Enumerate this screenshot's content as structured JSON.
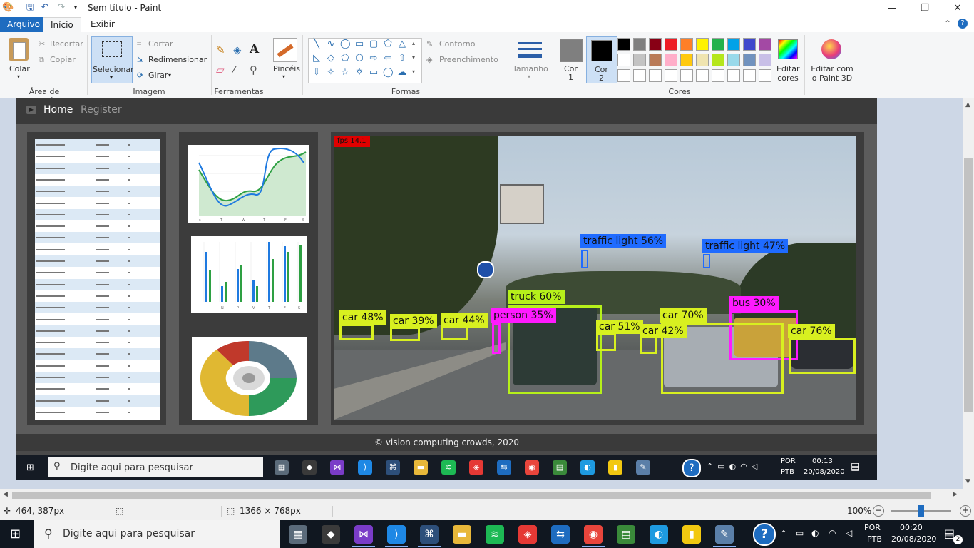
{
  "window": {
    "title": "Sem título - Paint",
    "controls": [
      "—",
      "❐",
      "✕"
    ]
  },
  "tabs": {
    "file": "Arquivo",
    "home": "Início",
    "view": "Exibir"
  },
  "ribbon": {
    "clipboard": {
      "paste": "Colar",
      "cut": "Recortar",
      "copy": "Copiar",
      "group": "Área de Transferência"
    },
    "image": {
      "select": "Selecionar",
      "crop": "Cortar",
      "resize": "Redimensionar",
      "rotate": "Girar",
      "group": "Imagem"
    },
    "tools": {
      "group": "Ferramentas"
    },
    "brushes": {
      "label": "Pincéis"
    },
    "shapes": {
      "outline": "Contorno",
      "fill": "Preenchimento",
      "group": "Formas"
    },
    "size": {
      "label": "Tamanho"
    },
    "colors": {
      "color1_label": "Cor",
      "color1_num": "1",
      "color2_label": "Cor",
      "color2_num": "2",
      "color1": "#7f7f7f",
      "color2": "#000000",
      "palette_row1": [
        "#000000",
        "#7f7f7f",
        "#880015",
        "#ed1c24",
        "#ff7f27",
        "#fff200",
        "#22b14c",
        "#00a2e8",
        "#3f48cc",
        "#a349a4"
      ],
      "palette_row2": [
        "#ffffff",
        "#c3c3c3",
        "#b97a57",
        "#ffaec9",
        "#ffc90e",
        "#efe4b0",
        "#b5e61d",
        "#99d9ea",
        "#7092be",
        "#c8bfe7"
      ],
      "edit_colors": "Editar cores",
      "group": "Cores"
    },
    "paint3d": "Editar com o Paint 3D"
  },
  "embedded": {
    "nav": {
      "home": "Home",
      "register": "Register"
    },
    "fps": "fps 14.1",
    "detections": [
      {
        "label": "traffic light 56%",
        "color": "#1f6bff"
      },
      {
        "label": "traffic light 47%",
        "color": "#1f6bff"
      },
      {
        "label": "truck 60%",
        "color": "#b6f01a"
      },
      {
        "label": "person 35%",
        "color": "#ff1aff"
      },
      {
        "label": "bus 30%",
        "color": "#ff1aff"
      },
      {
        "label": "car 48%",
        "color": "#d8f020"
      },
      {
        "label": "car 39%",
        "color": "#d8f020"
      },
      {
        "label": "car 44%",
        "color": "#d8f020"
      },
      {
        "label": "car 51%",
        "color": "#d8f020"
      },
      {
        "label": "car 70%",
        "color": "#d8f020"
      },
      {
        "label": "car 42%",
        "color": "#d8f020"
      },
      {
        "label": "car 76%",
        "color": "#d8f020"
      }
    ],
    "footer": "© vision computing   crowds, 2020",
    "inner_taskbar": {
      "search": "Digite aqui para pesquisar",
      "lang1": "POR",
      "lang2": "PTB",
      "time": "00:13",
      "date": "20/08/2020"
    }
  },
  "statusbar": {
    "cursor_pos": "464, 387px",
    "image_size": "1366 × 768px",
    "zoom": "100%"
  },
  "taskbar": {
    "search_placeholder": "Digite aqui para pesquisar",
    "lang1": "POR",
    "lang2": "PTB",
    "time": "00:20",
    "date": "20/08/2020",
    "notifications": "2"
  }
}
